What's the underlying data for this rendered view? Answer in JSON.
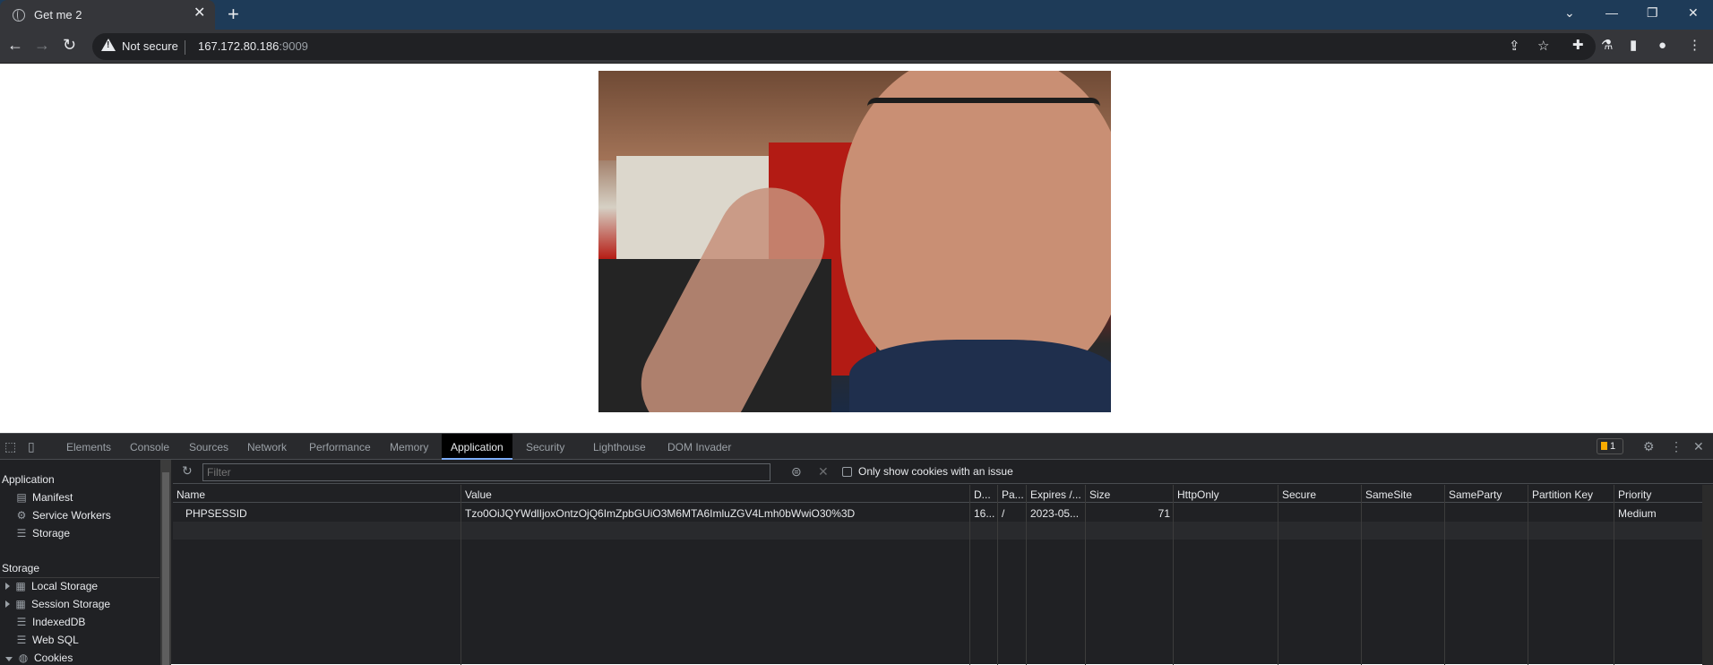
{
  "browser": {
    "tab_title": "Get me 2",
    "new_tab_symbol": "+",
    "omnibox": {
      "security_label": "Not secure",
      "host": "167.172.80.186",
      "port": ":9009"
    }
  },
  "devtools": {
    "tabs": [
      "Elements",
      "Console",
      "Sources",
      "Network",
      "Performance",
      "Memory",
      "Application",
      "Security",
      "Lighthouse",
      "DOM Invader"
    ],
    "active_tab": "Application",
    "issues_count": "1",
    "sidebar": {
      "application_header": "Application",
      "application_items": [
        "Manifest",
        "Service Workers",
        "Storage"
      ],
      "storage_header": "Storage",
      "storage_items": [
        "Local Storage",
        "Session Storage",
        "IndexedDB",
        "Web SQL",
        "Cookies"
      ]
    },
    "cookies": {
      "filter_placeholder": "Filter",
      "only_issues_label": "Only show cookies with an issue",
      "columns": [
        "Name",
        "Value",
        "D...",
        "Pa...",
        "Expires /...",
        "Size",
        "HttpOnly",
        "Secure",
        "SameSite",
        "SameParty",
        "Partition Key",
        "Priority"
      ],
      "rows": [
        {
          "name": "PHPSESSID",
          "value": "Tzo0OiJQYWdlIjoxOntzOjQ6ImZpbGUiO3M6MTA6ImluZGV4Lmh0bWwiO30%3D",
          "domain": "16...",
          "path": "/",
          "expires": "2023-05...",
          "size": "71",
          "httponly": "",
          "secure": "",
          "samesite": "",
          "sameparty": "",
          "partition_key": "",
          "priority": "Medium"
        }
      ]
    }
  }
}
